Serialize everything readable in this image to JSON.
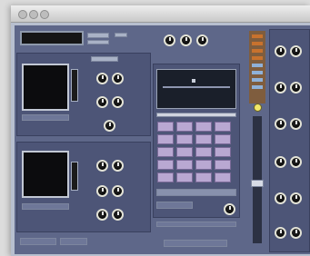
{
  "window": {
    "title": ""
  },
  "colors": {
    "rack": "#5e6789",
    "panel": "#4d5577",
    "pad": "#b9a8d2",
    "knob_ring": "#e2e2d6",
    "led": "#f1e76a",
    "meter": "#c8722e"
  },
  "icons": {
    "window_controls": [
      "close-icon",
      "minimize-icon",
      "zoom-icon"
    ]
  }
}
